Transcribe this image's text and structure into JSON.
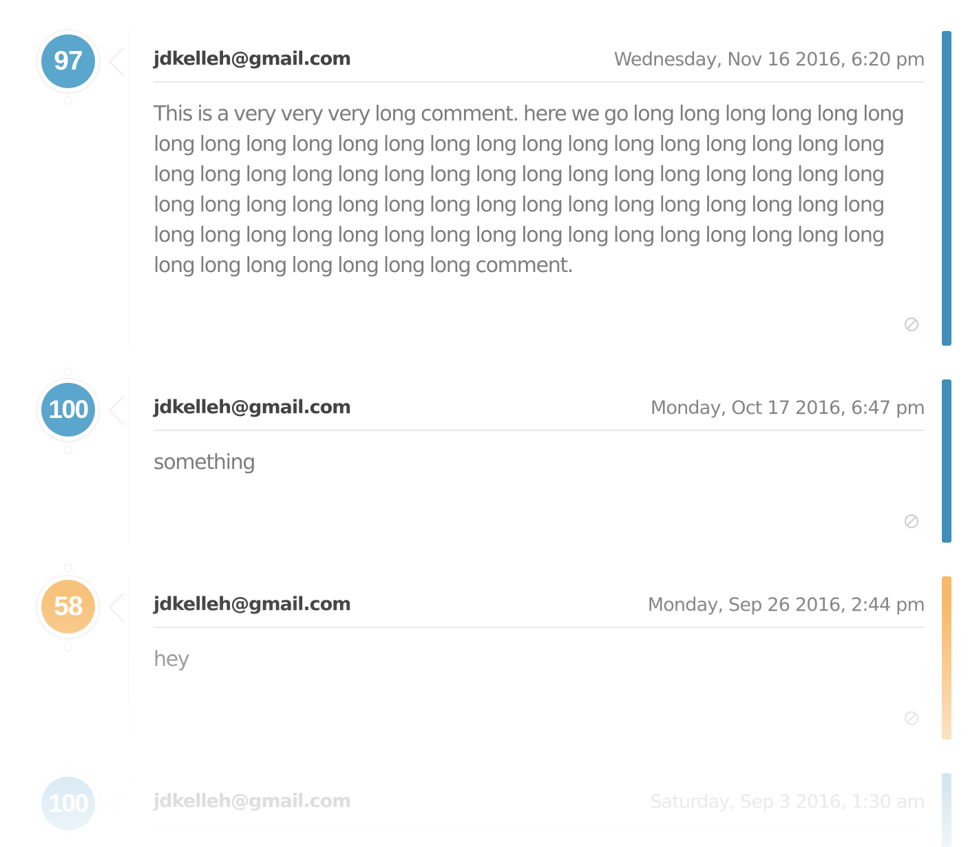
{
  "colors": {
    "blue": "#5aa6cc",
    "blue_bar": "#3f8fba",
    "orange": "#f7c37c",
    "orange_bar": "#f6b968"
  },
  "comments": [
    {
      "score": "97",
      "author": "jdkelleh@gmail.com",
      "timestamp": "Wednesday, Nov 16 2016, 6:20 pm",
      "body": "This is a very very very long comment. here we go long long long long long long long long long long long long long long long long long long long long long long long long long long long long long long long long long long long long long long long long long long long long long long long long long long long long long long long long long long long long long long long long long long long long long long long long long long long long long comment.",
      "color": "blue",
      "flag_icon": "flag-icon"
    },
    {
      "score": "100",
      "author": "jdkelleh@gmail.com",
      "timestamp": "Monday, Oct 17 2016, 6:47 pm",
      "body": "something",
      "color": "blue",
      "flag_icon": "flag-icon"
    },
    {
      "score": "58",
      "author": "jdkelleh@gmail.com",
      "timestamp": "Monday, Sep 26 2016, 2:44 pm",
      "body": "hey",
      "color": "orange",
      "flag_icon": "flag-icon"
    },
    {
      "score": "100",
      "author": "jdkelleh@gmail.com",
      "timestamp": "Saturday, Sep 3 2016, 1:30 am",
      "body": "",
      "color": "blue",
      "flag_icon": "flag-icon"
    }
  ]
}
